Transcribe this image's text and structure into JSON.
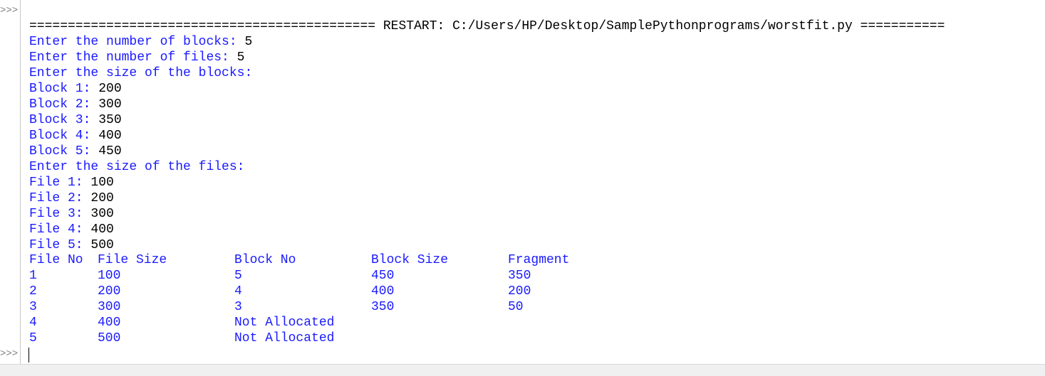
{
  "shell": {
    "prompt_symbol": ">>>",
    "restart_line": "============================================= RESTART: C:/Users/HP/Desktop/SamplePythonprograms/worstfit.py ===========",
    "input_prompts": [
      {
        "prompt": "Enter the number of blocks: ",
        "value": "5"
      },
      {
        "prompt": "Enter the number of files: ",
        "value": "5"
      },
      {
        "prompt": "Enter the size of the blocks:",
        "value": ""
      },
      {
        "prompt": "Block 1: ",
        "value": "200"
      },
      {
        "prompt": "Block 2: ",
        "value": "300"
      },
      {
        "prompt": "Block 3: ",
        "value": "350"
      },
      {
        "prompt": "Block 4: ",
        "value": "400"
      },
      {
        "prompt": "Block 5: ",
        "value": "450"
      },
      {
        "prompt": "Enter the size of the files:",
        "value": ""
      },
      {
        "prompt": "File 1: ",
        "value": "100"
      },
      {
        "prompt": "File 2: ",
        "value": "200"
      },
      {
        "prompt": "File 3: ",
        "value": "300"
      },
      {
        "prompt": "File 4: ",
        "value": "400"
      },
      {
        "prompt": "File 5: ",
        "value": "500"
      }
    ],
    "table": {
      "headers": [
        "File No",
        "File Size",
        "Block No",
        "Block Size",
        "Fragment"
      ],
      "rows": [
        [
          "1",
          "100",
          "5",
          "450",
          "350"
        ],
        [
          "2",
          "200",
          "4",
          "400",
          "200"
        ],
        [
          "3",
          "300",
          "3",
          "350",
          "50"
        ],
        [
          "4",
          "400",
          "Not Allocated",
          "",
          ""
        ],
        [
          "5",
          "500",
          "Not Allocated",
          "",
          ""
        ]
      ]
    }
  },
  "colors": {
    "output_blue": "#1a1aff",
    "input_black": "#000000",
    "gutter_line": "#c8c8c8",
    "prompt_gray": "#7f7f7f"
  }
}
